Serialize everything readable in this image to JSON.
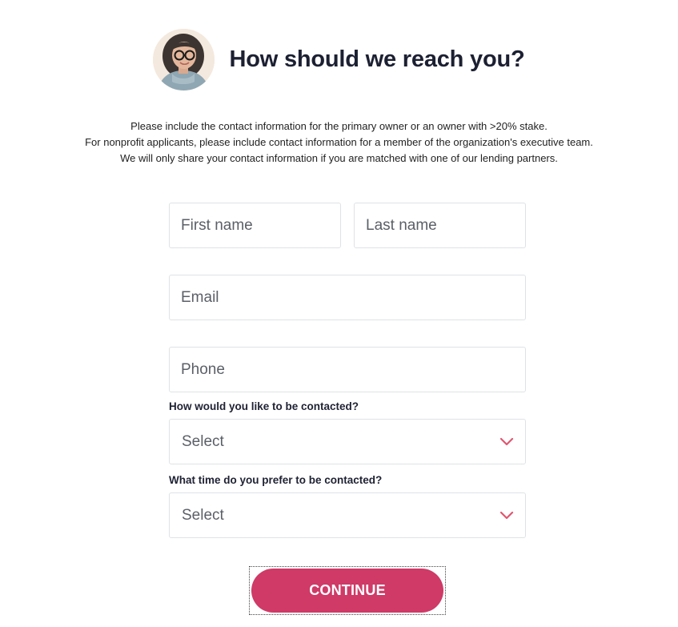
{
  "header": {
    "title": "How should we reach you?",
    "avatar_icon": "person-avatar-icon"
  },
  "intro": {
    "lines": [
      "Please include the contact information for the primary owner or an owner with >20% stake.",
      "For nonprofit applicants, please include contact information for a member of the organization's executive team.",
      "We will only share your contact information if you are matched with one of our lending partners."
    ]
  },
  "form": {
    "first_name": {
      "placeholder": "First name",
      "value": ""
    },
    "last_name": {
      "placeholder": "Last name",
      "value": ""
    },
    "email": {
      "placeholder": "Email",
      "value": ""
    },
    "phone": {
      "placeholder": "Phone",
      "value": ""
    },
    "contact_method": {
      "label": "How would you like to be contacted?",
      "selected": "Select",
      "icon": "chevron-down-icon"
    },
    "contact_time": {
      "label": "What time do you prefer to be contacted?",
      "selected": "Select",
      "icon": "chevron-down-icon"
    }
  },
  "actions": {
    "continue_label": "CONTINUE"
  },
  "colors": {
    "accent": "#cf3a67",
    "chevron": "#e0566f",
    "title": "#1c2032",
    "border": "#dfe2e6"
  }
}
